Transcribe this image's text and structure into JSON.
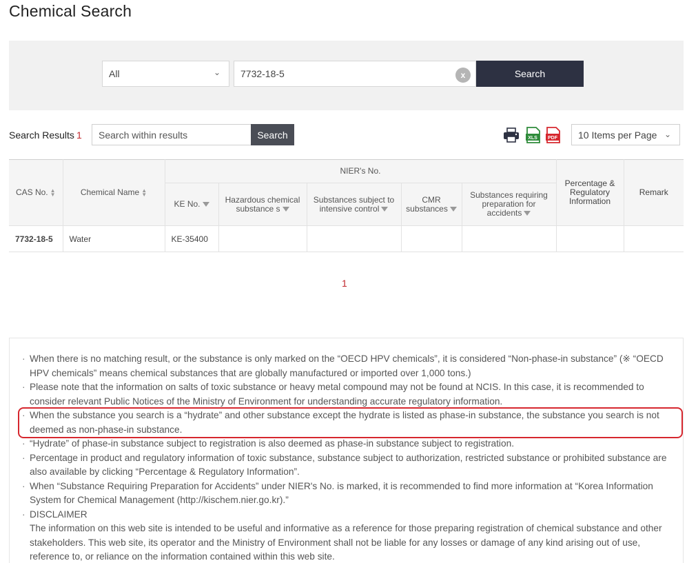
{
  "page": {
    "title": "Chemical Search"
  },
  "search": {
    "category_value": "All",
    "query_value": "7732-18-5",
    "clear_label": "x",
    "search_label": "Search"
  },
  "results": {
    "label": "Search Results",
    "count": "1",
    "within_placeholder": "Search within results",
    "within_button": "Search",
    "per_page": "10 Items per Page"
  },
  "icons": {
    "print": "printer-icon",
    "xls": "xls-export-icon",
    "pdf": "pdf-export-icon"
  },
  "colors": {
    "accent_red": "#c1272d",
    "search_button": "#2d3142",
    "highlight": "#d6272e"
  },
  "table": {
    "headers": {
      "cas": "CAS No.",
      "name": "Chemical Name",
      "nier": "NIER's No.",
      "ke": "KE No.",
      "hazardous": "Hazardous chemical substance s",
      "intensive": "Substances subject to intensive control",
      "cmr": "CMR substances",
      "accidents": "Substances requiring preparation for accidents",
      "percentage": "Percentage & Regulatory Information",
      "remark": "Remark"
    },
    "rows": [
      {
        "cas": "7732-18-5",
        "name": "Water",
        "ke": "KE-35400",
        "hazardous": "",
        "intensive": "",
        "cmr": "",
        "accidents": "",
        "percentage": "",
        "remark": ""
      }
    ]
  },
  "pagination": {
    "current": "1"
  },
  "notices": [
    "When there is no matching result, or the substance is only marked on the “OECD HPV chemicals”, it is considered “Non-phase-in substance” (※ “OECD HPV chemicals” means chemical substances that are globally manufactured or imported over 1,000 tons.)",
    "Please note that the information on salts of toxic substance or heavy metal compound may not be found at NCIS. In this case, it is recommended to consider relevant Public Notices of the Ministry of Environment for understanding accurate regulatory information.",
    "When the substance you search is a “hydrate” and other substance except the hydrate is listed as phase-in substance, the substance you search is not deemed as non-phase-in substance.",
    "“Hydrate” of phase-in substance subject to registration is also deemed as phase-in substance subject to registration.",
    "Percentage in product and regulatory information of toxic substance, substance subject to authorization, restricted substance or prohibited substance are also available by clicking “Percentage & Regulatory Information”.",
    "When “Substance Requiring Preparation for Accidents” under NIER's No. is marked, it is recommended to find more information at “Korea Information System for Chemical Management (http://kischem.nier.go.kr).”",
    "DISCLAIMER"
  ],
  "disclaimer": "The information on this web site is intended to be useful and informative as a reference for those preparing registration of chemical substance and other stakeholders. This web site, its operator and the Ministry of Environment shall not be liable for any losses or damage of any kind arising out of use, reference to, or reliance on the information contained within this web site."
}
